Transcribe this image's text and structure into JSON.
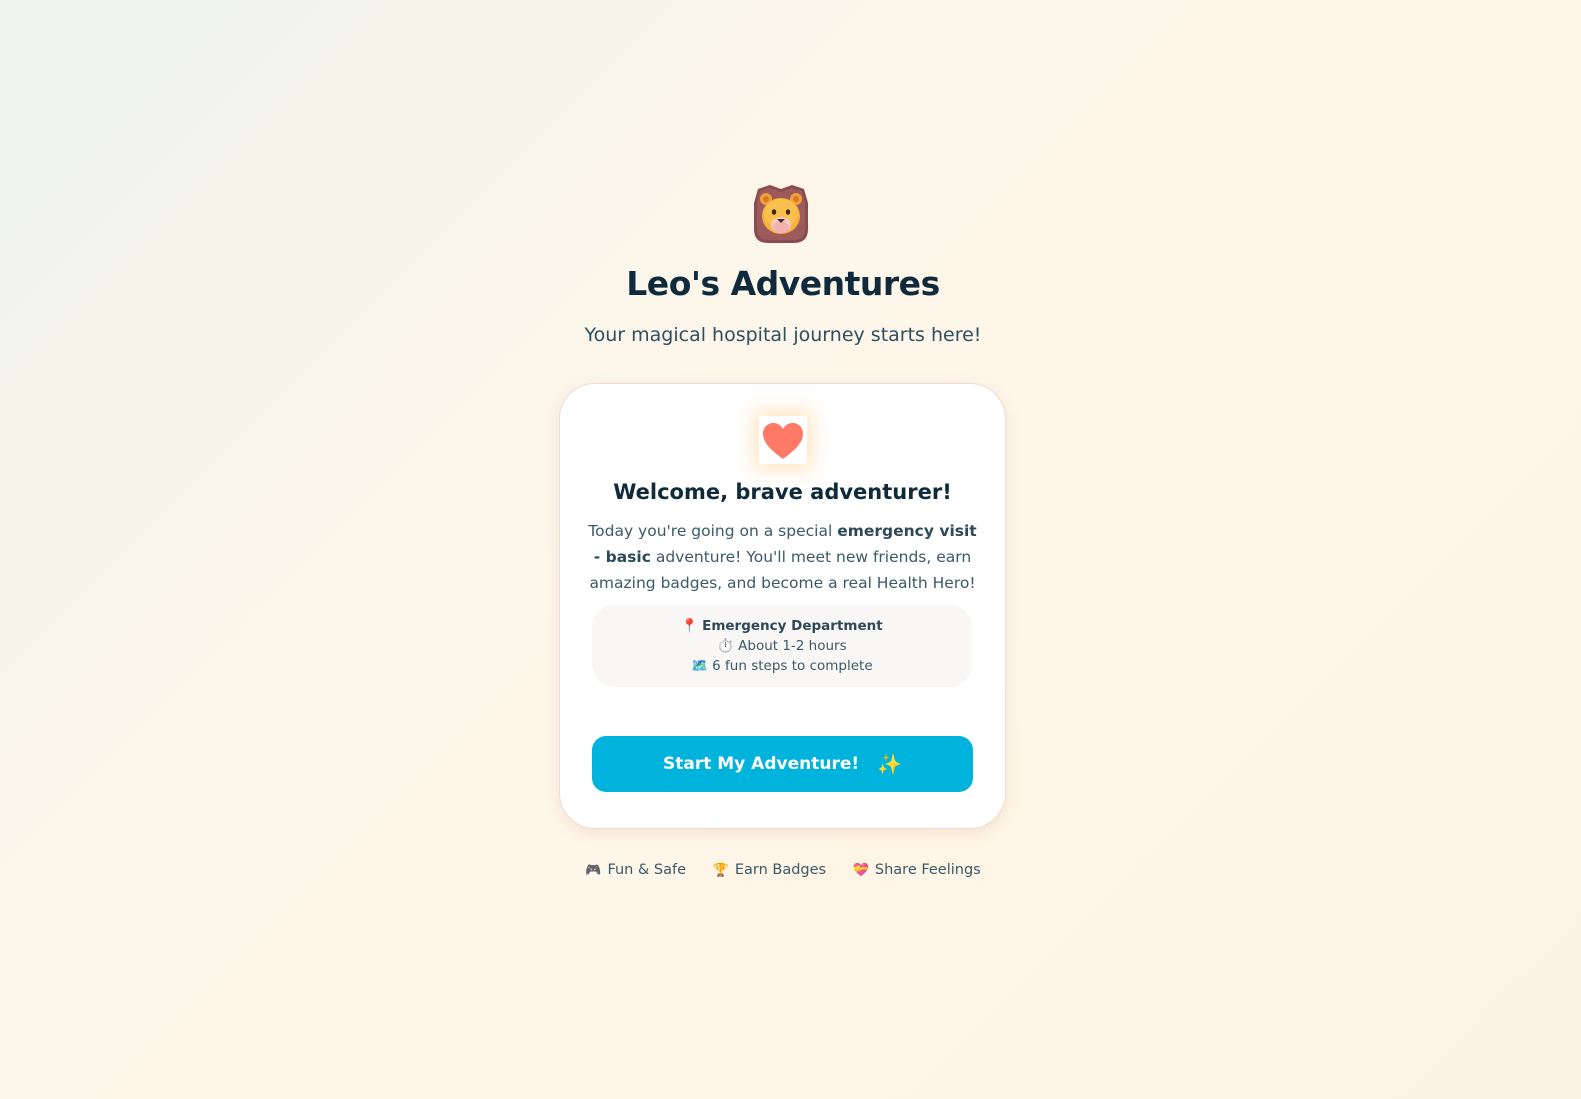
{
  "header": {
    "mascot_icon": "lion-face-icon",
    "title": "Leo's Adventures",
    "subtitle": "Your magical hospital journey starts here!"
  },
  "card": {
    "icon": "heart-icon",
    "icon_color": "#ff7a66",
    "title": "Welcome, brave adventurer!",
    "text_before": "Today you're going on a special ",
    "text_bold": "emergency visit - basic",
    "text_after": " adventure! You'll meet new friends, earn amazing badges, and become a real Health Hero!",
    "info": [
      {
        "icon": "📍",
        "icon_name": "pin-icon",
        "text": "Emergency Department"
      },
      {
        "icon": "⏱️",
        "icon_name": "stopwatch-icon",
        "text": "About 1-2 hours"
      },
      {
        "icon": "🗺️",
        "icon_name": "map-icon",
        "text": "6 fun steps to complete"
      }
    ],
    "button_label": "Start My Adventure!",
    "button_icon": "✨",
    "button_color": "#00b3dd"
  },
  "features": [
    {
      "icon": "🎮",
      "icon_name": "game-controller-icon",
      "label": "Fun & Safe"
    },
    {
      "icon": "🏆",
      "icon_name": "trophy-icon",
      "label": "Earn Badges"
    },
    {
      "icon": "💝",
      "icon_name": "heart-gift-icon",
      "label": "Share Feelings"
    }
  ]
}
